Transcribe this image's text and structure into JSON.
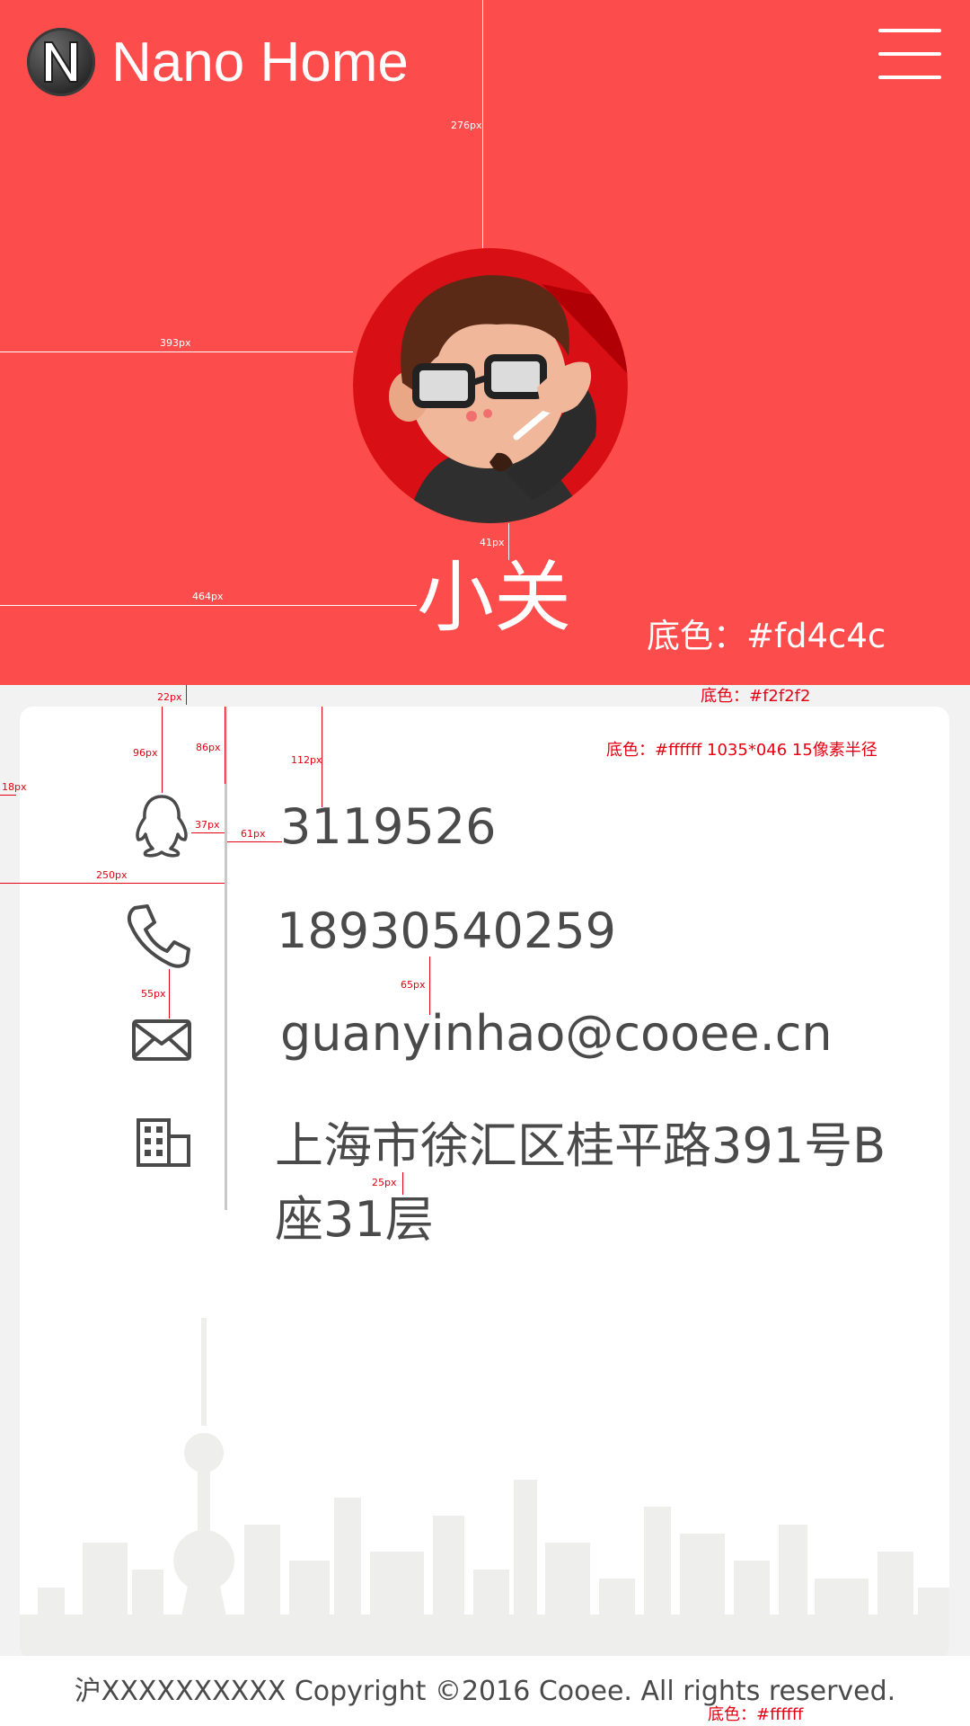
{
  "header": {
    "app_title": "Nano Home",
    "logo_icon": "n-logo-icon",
    "menu_icon": "hamburger-menu-icon",
    "background_color": "#fd4c4c"
  },
  "profile": {
    "avatar_icon": "cartoon-avatar",
    "name": "小关"
  },
  "annotations": {
    "header_bg": "底色：#fd4c4c",
    "page_bg": "底色：#f2f2f2",
    "card_spec": "底色：#ffffff   1035*046    15像素半径",
    "footer_bg": "底色：#ffffff",
    "measurements": {
      "m276": "276px",
      "m393": "393px",
      "m41": "41px",
      "m464": "464px",
      "m22": "22px",
      "m96": "96px",
      "m86": "86px",
      "m112": "112px",
      "m18": "18px",
      "m37": "37px",
      "m61": "61px",
      "m250": "250px",
      "m55": "55px",
      "m65": "65px",
      "m25": "25px"
    }
  },
  "contact": {
    "qq": {
      "icon": "qq-penguin-icon",
      "value": "3119526"
    },
    "phone": {
      "icon": "phone-icon",
      "value": "18930540259"
    },
    "email": {
      "icon": "mail-icon",
      "value": "guanyinhao@cooee.cn"
    },
    "address": {
      "icon": "building-icon",
      "value": "上海市徐汇区桂平路391号B座31层"
    }
  },
  "footer": {
    "text": "沪XXXXXXXXXX  Copyright ©2016 Cooee. All rights reserved."
  }
}
